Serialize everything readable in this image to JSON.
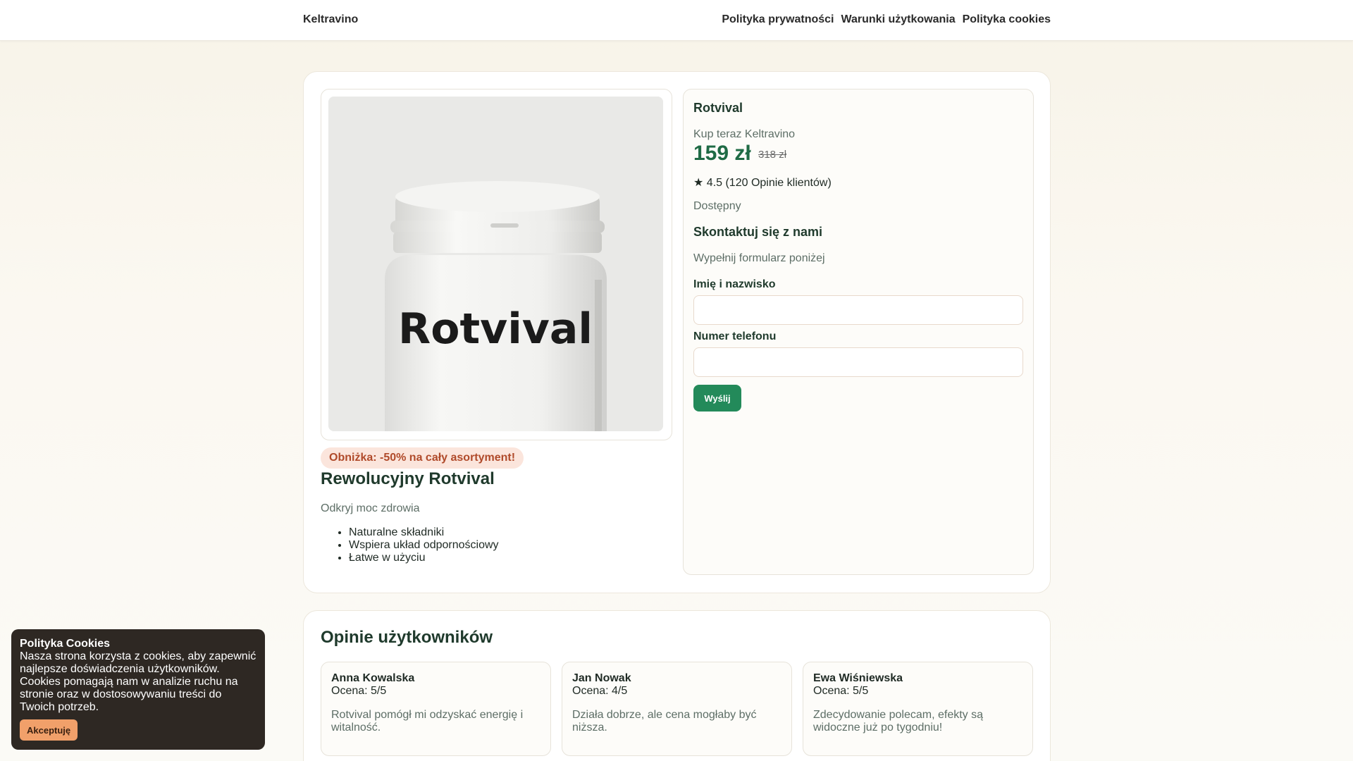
{
  "header": {
    "brand": "Keltravino",
    "nav": [
      "Polityka prywatności",
      "Warunki użytkowania",
      "Polityka cookies"
    ]
  },
  "product": {
    "image_label": "Rotvival",
    "promo": "Obniżka: -50% na cały asortyment!",
    "title": "Rewolucyjny Rotvival",
    "subtitle": "Odkryj moc zdrowia",
    "features": [
      "Naturalne składniki",
      "Wspiera układ odpornościowy",
      "Łatwe w użyciu"
    ]
  },
  "order_panel": {
    "title": "Rotvival",
    "buy_label": "Kup teraz Keltravino",
    "price": "159 zł",
    "old_price": "318 zł",
    "rating": "★ 4.5 (120 Opinie klientów)",
    "availability": "Dostępny",
    "contact_title": "Skontaktuj się z nami",
    "contact_sub": "Wypełnij formularz poniżej",
    "name_label": "Imię i nazwisko",
    "name_value": "",
    "phone_label": "Numer telefonu",
    "phone_value": "",
    "submit_label": "Wyślij"
  },
  "reviews": {
    "title": "Opinie użytkowników",
    "items": [
      {
        "name": "Anna Kowalska",
        "rating": "Ocena: 5/5",
        "text": "Rotvival pomógł mi odzyskać energię i witalność."
      },
      {
        "name": "Jan Nowak",
        "rating": "Ocena: 4/5",
        "text": "Działa dobrze, ale cena mogłaby być niższa."
      },
      {
        "name": "Ewa Wiśniewska",
        "rating": "Ocena: 5/5",
        "text": "Zdecydowanie polecam, efekty są widoczne już po tygodniu!"
      }
    ]
  },
  "cookie": {
    "title": "Polityka Cookies",
    "text": "Nasza strona korzysta z cookies, aby zapewnić najlepsze doświadczenia użytkowników. Cookies pomagają nam w analizie ruchu na stronie oraz w dostosowywaniu treści do Twoich potrzeb.",
    "accept_label": "Akceptuję"
  },
  "colors": {
    "accent_green": "#238a5a",
    "price_green": "#1f6b45",
    "promo_bg": "#fbe5dc",
    "promo_text": "#b04a2a",
    "cookie_bg": "#2e2823",
    "cookie_button": "#f1a06a"
  }
}
